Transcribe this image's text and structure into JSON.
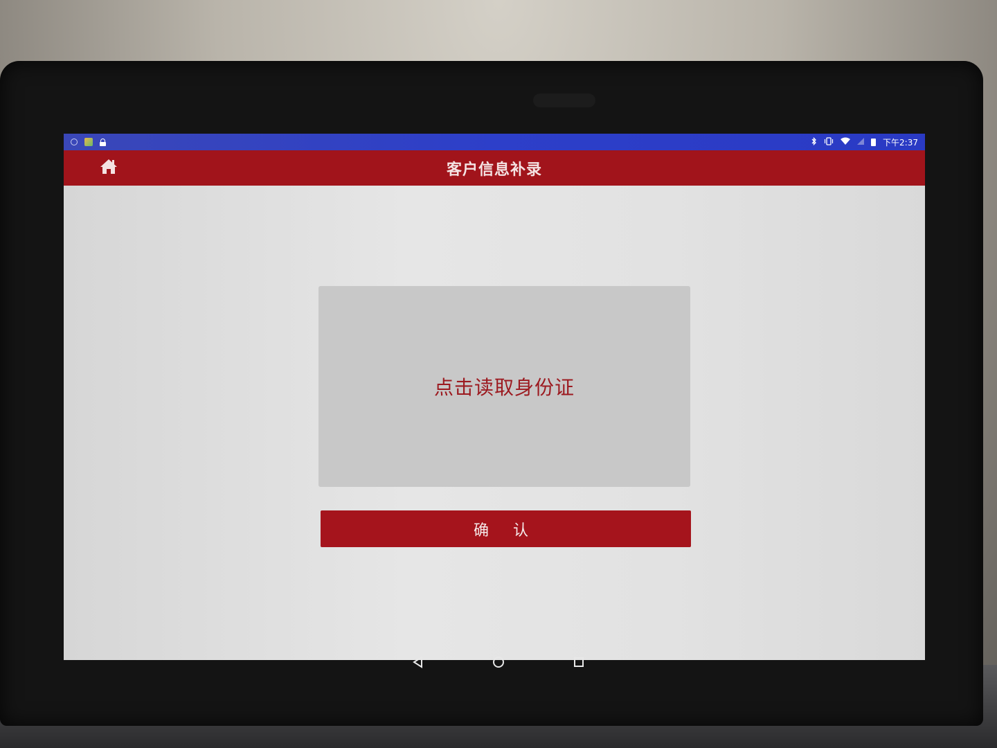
{
  "status_bar": {
    "time": "下午2:37"
  },
  "app_bar": {
    "title": "客户信息补录"
  },
  "main": {
    "read_id_card_label": "点击读取身份证",
    "confirm_label": "确 认"
  },
  "colors": {
    "brand_red": "#a1141b",
    "status_blue": "#2d3fc9",
    "card_gray": "#c8c8c8"
  },
  "icons": {
    "home": "home-icon",
    "nav_back": "back-triangle-icon",
    "nav_home": "home-circle-icon",
    "nav_recents": "recents-square-icon"
  }
}
